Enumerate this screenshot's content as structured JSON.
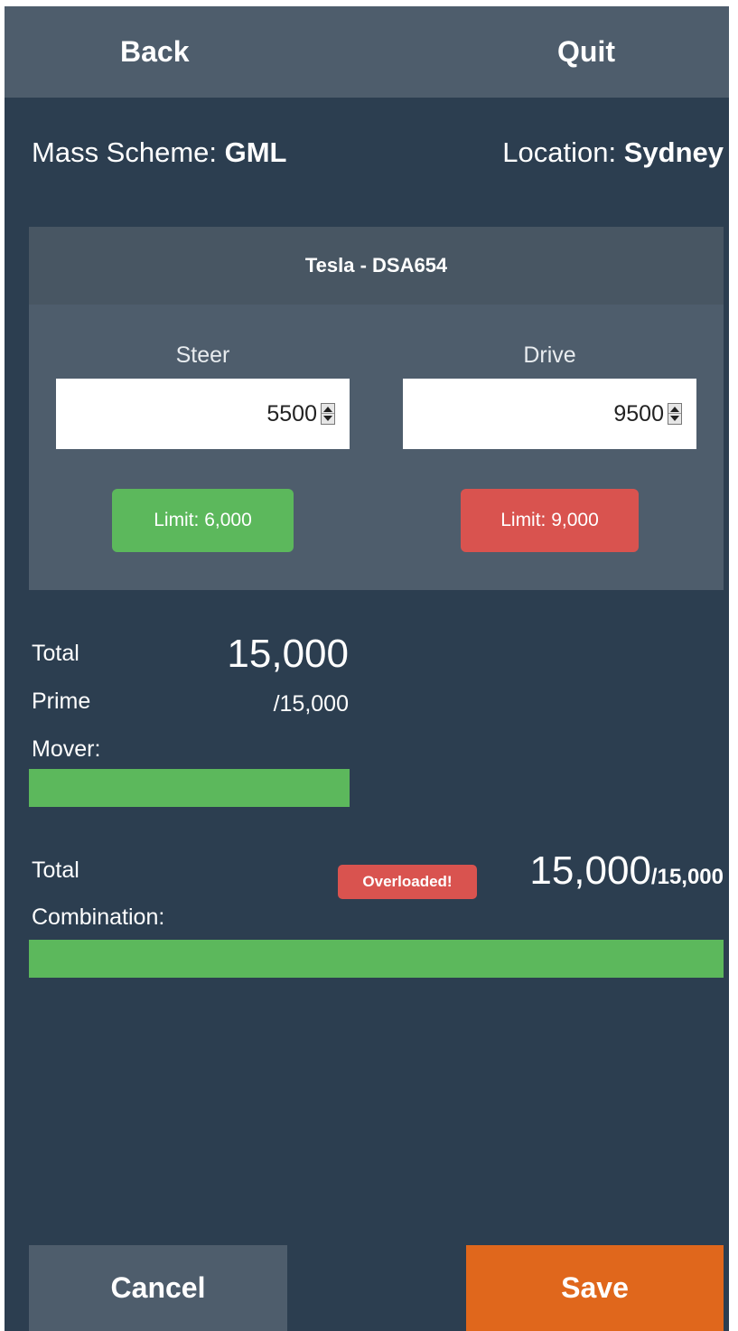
{
  "header": {
    "back_label": "Back",
    "quit_label": "Quit"
  },
  "meta": {
    "mass_scheme_label": "Mass Scheme: ",
    "mass_scheme_value": "GML",
    "location_label": "Location: ",
    "location_value": "Sydney"
  },
  "vehicle": {
    "title": "Tesla - DSA654",
    "steer": {
      "label": "Steer",
      "value": "5500",
      "limit": "Limit: 6,000",
      "status": "ok"
    },
    "drive": {
      "label": "Drive",
      "value": "9500",
      "limit": "Limit: 9,000",
      "status": "over"
    }
  },
  "prime_mover": {
    "label_line1": "Total",
    "label_line2": "Prime",
    "label_line3": "Mover:",
    "total": "15,000",
    "capacity": "/15,000",
    "progress_percent": 100
  },
  "combination": {
    "label_line1": "Total",
    "label_line2": "Combination:",
    "badge": "Overloaded!",
    "total": "15,000",
    "capacity": "/15,000",
    "progress_percent": 100
  },
  "footer": {
    "cancel_label": "Cancel",
    "save_label": "Save"
  },
  "colors": {
    "background": "#2c3e50",
    "panel": "#4e5d6c",
    "success": "#5cb85c",
    "danger": "#d9534f",
    "accent": "#e0671c"
  }
}
